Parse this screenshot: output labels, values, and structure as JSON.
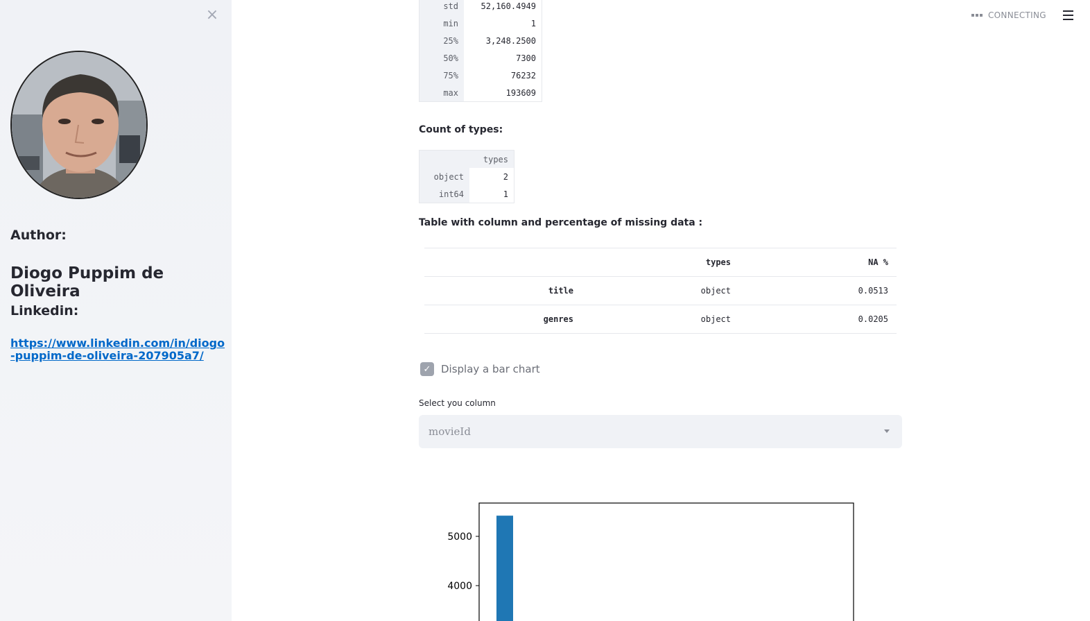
{
  "sidebar": {
    "close_glyph": "×",
    "author_label": "Author:",
    "author_name": "Diogo Puppim de Oliveira",
    "linkedin_label": "Linkedin:",
    "linkedin_url": "https://www.linkedin.com/in/diogo-puppim-de-oliveira-207905a7/"
  },
  "status": {
    "text": "CONNECTING"
  },
  "stats_table": {
    "rows": [
      {
        "label": "std",
        "value": "52,160.4949"
      },
      {
        "label": "min",
        "value": "1"
      },
      {
        "label": "25%",
        "value": "3,248.2500"
      },
      {
        "label": "50%",
        "value": "7300"
      },
      {
        "label": "75%",
        "value": "76232"
      },
      {
        "label": "max",
        "value": "193609"
      }
    ]
  },
  "count_types": {
    "title": "Count of types:",
    "header": "types",
    "rows": [
      {
        "label": "object",
        "value": "2"
      },
      {
        "label": "int64",
        "value": "1"
      }
    ]
  },
  "missing": {
    "title": "Table with column and percentage of missing data :",
    "headers": [
      "",
      "types",
      "NA %"
    ],
    "rows": [
      {
        "name": "title",
        "type": "object",
        "na": "0.0513"
      },
      {
        "name": "genres",
        "type": "object",
        "na": "0.0205"
      }
    ]
  },
  "checkbox": {
    "label": "Display a bar chart",
    "checked": true
  },
  "select": {
    "label": "Select you column",
    "value": "movieId"
  },
  "chart_data": {
    "type": "bar",
    "y_ticks": [
      4000,
      5000
    ],
    "bars": [
      {
        "value": 5420
      }
    ],
    "color": "#1f77b4"
  }
}
